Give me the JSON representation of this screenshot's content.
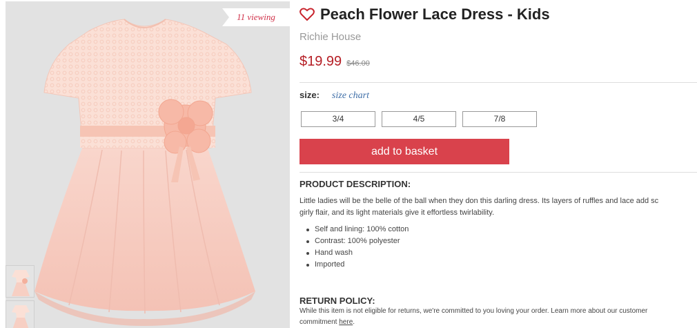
{
  "gallery": {
    "viewing_badge": "11 viewing",
    "hero_alt": "peach-dress-photo",
    "thumbnails": [
      "thumbnail-1",
      "thumbnail-2"
    ]
  },
  "product": {
    "title": "Peach Flower Lace Dress - Kids",
    "brand": "Richie House",
    "price": "$19.99",
    "original_price": "$46.00",
    "wishlist_icon": "heart-outline-icon"
  },
  "sizes": {
    "label": "size:",
    "chart_link": "size chart",
    "options": [
      "3/4",
      "4/5",
      "7/8"
    ]
  },
  "cart": {
    "add_label": "add to basket"
  },
  "description": {
    "heading": "PRODUCT DESCRIPTION:",
    "line1": "Little ladies will be the belle of the ball when they don this darling dress. Its layers of ruffles and lace add sc",
    "line2": "girly flair, and its light materials give it effortless twirlability.",
    "bullets": [
      "Self and lining: 100% cotton",
      "Contrast: 100% polyester",
      "Hand wash",
      "Imported"
    ]
  },
  "return_policy": {
    "heading": "RETURN POLICY:",
    "line1": "While this item is not eligible for returns, we're committed to you loving your order. Learn more about our customer",
    "line2_prefix": "commitment ",
    "link": "here",
    "line2_suffix": "."
  },
  "colors": {
    "accent_red": "#d9424c",
    "price_red": "#b51d24",
    "link_blue": "#3f6fa8",
    "badge_red": "#d0324a",
    "dress_pink": "#f7d3c9"
  }
}
